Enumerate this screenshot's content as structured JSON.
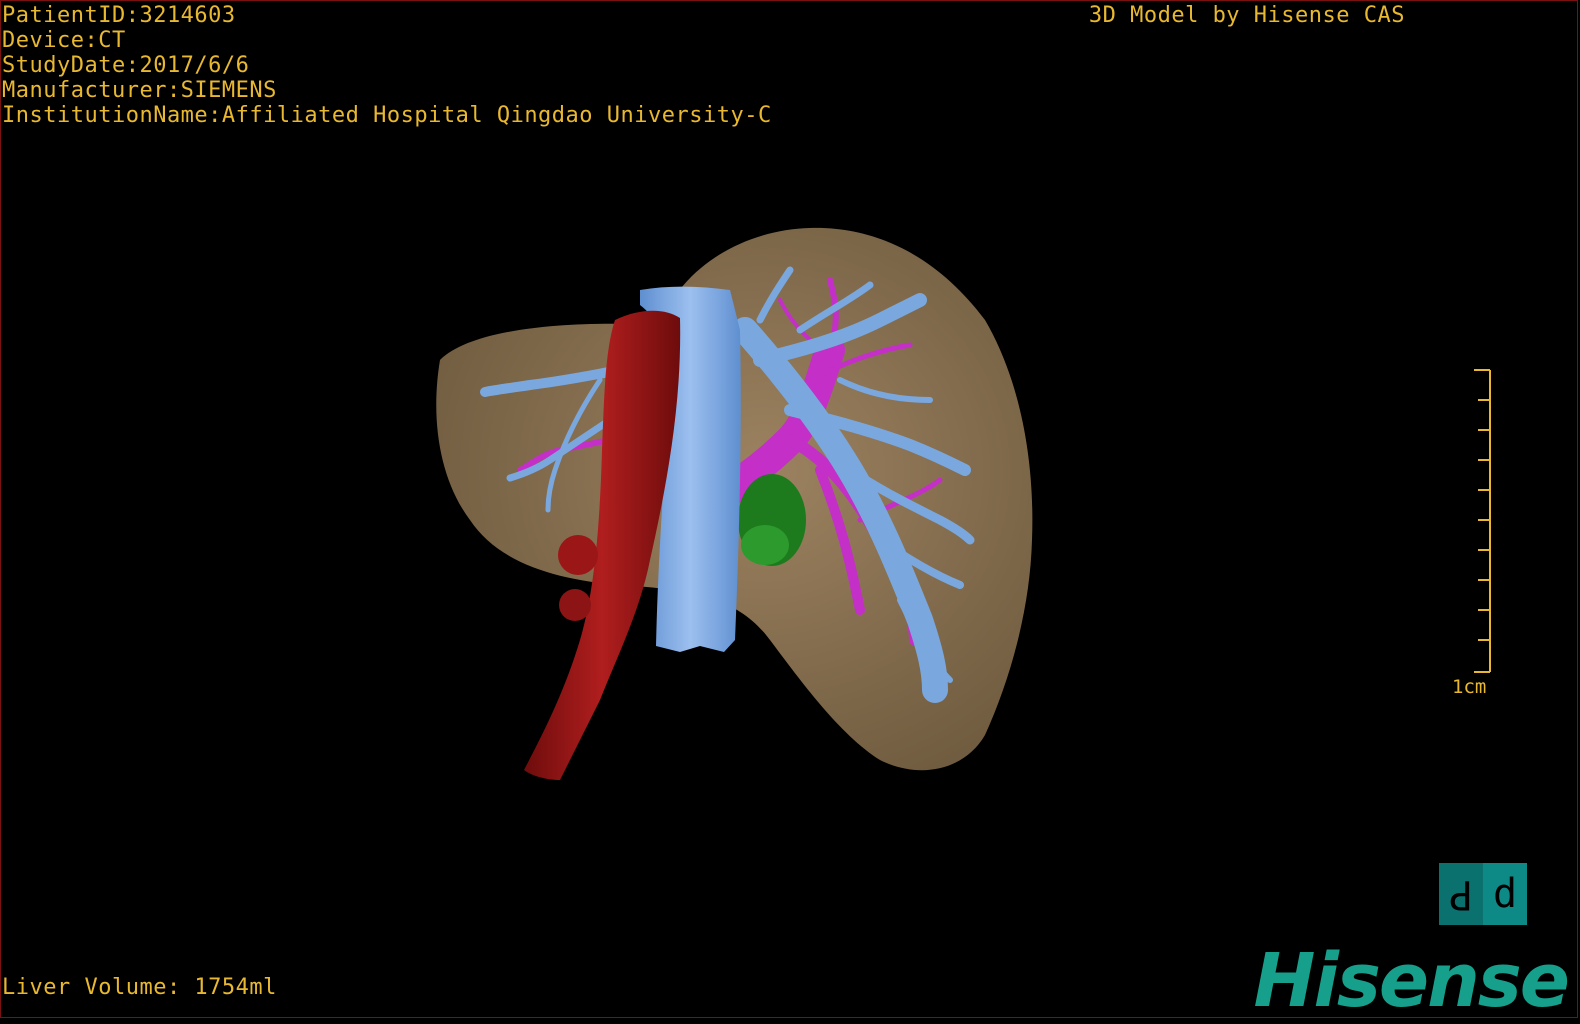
{
  "overlay": {
    "patient_id": "PatientID:3214603",
    "device": "Device:CT",
    "study_date": "StudyDate:2017/6/6",
    "manufacturer": "Manufacturer:SIEMENS",
    "institution": "InstitutionName:Affiliated Hospital Qingdao University-C",
    "credit": "3D Model by Hisense CAS",
    "liver_volume": "Liver Volume: 1754ml"
  },
  "scale_bar": {
    "label": "1cm"
  },
  "orientation_cube": {
    "left_glyph": "P",
    "right_glyph": "d"
  },
  "brand": {
    "name": "Hisense"
  },
  "colors": {
    "text": "#e8b830",
    "liver": "#8c7350",
    "hepatic_vein": "#7aa8de",
    "portal_vein": "#c42fc8",
    "artery": "#9b1616",
    "lesion": "#1d7a1d",
    "brand": "#16a08c"
  }
}
